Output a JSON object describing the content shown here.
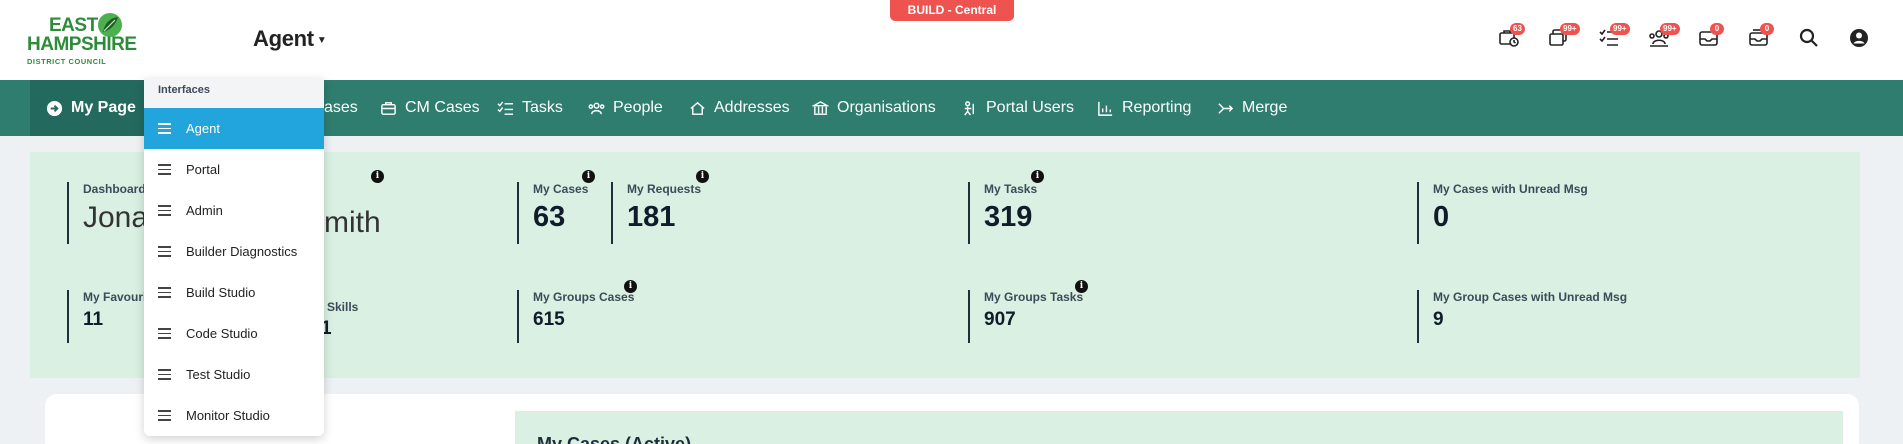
{
  "header": {
    "logo": {
      "line1": "EAST",
      "line2": "HAMPSHIRE",
      "line3": "DISTRICT COUNCIL"
    },
    "interface_label": "Agent",
    "env_badge": "BUILD - Central",
    "icons": [
      {
        "name": "cases-clock-icon",
        "badge": "63"
      },
      {
        "name": "windows-icon",
        "badge": "99+"
      },
      {
        "name": "tasks-list-icon",
        "badge": "99+"
      },
      {
        "name": "group-users-icon",
        "badge": "99+"
      },
      {
        "name": "inbox-icon",
        "badge": "0"
      },
      {
        "name": "group-inbox-icon",
        "badge": "0"
      },
      {
        "name": "search-icon",
        "badge": ""
      },
      {
        "name": "user-account-icon",
        "badge": ""
      }
    ]
  },
  "nav": {
    "items": [
      {
        "label": "My Page",
        "icon": "arrow-circle-icon"
      },
      {
        "label": "ases",
        "icon": ""
      },
      {
        "label": "CM Cases",
        "icon": "briefcase-icon"
      },
      {
        "label": "Tasks",
        "icon": "tasks-icon"
      },
      {
        "label": "People",
        "icon": "people-icon"
      },
      {
        "label": "Addresses",
        "icon": "home-icon"
      },
      {
        "label": "Organisations",
        "icon": "bank-icon"
      },
      {
        "label": "Portal Users",
        "icon": "portal-user-icon"
      },
      {
        "label": "Reporting",
        "icon": "chart-icon"
      },
      {
        "label": "Merge",
        "icon": "merge-icon"
      }
    ]
  },
  "dashboard": {
    "greeting_label": "Dashboard",
    "user_name_left": "Jona",
    "user_name_right": "mith",
    "metrics": {
      "my_cases": {
        "label": "My Cases",
        "value": "63"
      },
      "my_requests": {
        "label": "My Requests",
        "value": "181"
      },
      "my_tasks": {
        "label": "My Tasks",
        "value": "319"
      },
      "my_unread": {
        "label": "My Cases with Unread Msg",
        "value": "0"
      },
      "my_favourites": {
        "label": "My Favouri",
        "value": "11"
      },
      "my_skills": {
        "label": "Skills",
        "value": "1"
      },
      "group_cases": {
        "label": "My Groups Cases",
        "value": "615"
      },
      "group_tasks": {
        "label": "My Groups Tasks",
        "value": "907"
      },
      "group_unread": {
        "label": "My Group Cases with Unread Msg",
        "value": "9"
      }
    },
    "lower_card_title": "My Cases (Active)"
  },
  "dropdown": {
    "heading": "Interfaces",
    "items": [
      "Agent",
      "Portal",
      "Admin",
      "Builder Diagnostics",
      "Build Studio",
      "Code Studio",
      "Test Studio",
      "Monitor Studio"
    ],
    "selected": "Agent"
  },
  "colors": {
    "nav_bg": "#2e7d6f",
    "dash_bg": "#d9f0e2",
    "badge_red": "#ef5350",
    "selected_blue": "#21a5dc",
    "logo_green": "#2e8b3a"
  }
}
